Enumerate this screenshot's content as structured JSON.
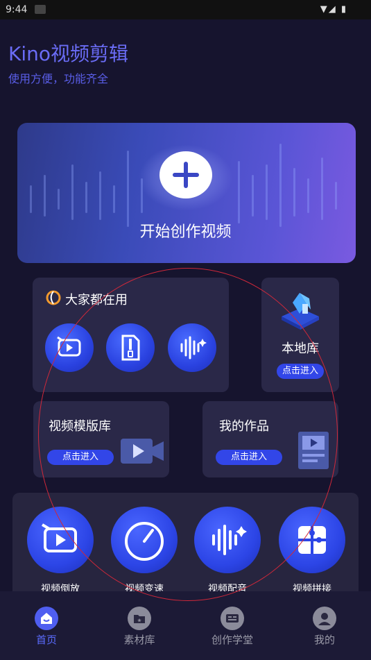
{
  "status_bar": {
    "time": "9:44",
    "right_icons": "▼◢ ▮"
  },
  "header": {
    "title": "Kino视频剪辑",
    "subtitle": "使用方便，功能齐全"
  },
  "hero": {
    "label": "开始创作视频",
    "icon": "plus-icon"
  },
  "popular": {
    "title": "大家都在用",
    "tools": [
      {
        "icon": "video-reverse-icon"
      },
      {
        "icon": "zip-file-icon"
      },
      {
        "icon": "audio-wave-icon"
      }
    ]
  },
  "local_library": {
    "title": "本地库",
    "button": "点击进入"
  },
  "templates": {
    "title": "视频模版库",
    "button": "点击进入"
  },
  "my_works": {
    "title": "我的作品",
    "button": "点击进入"
  },
  "tools": [
    {
      "label": "视频倒放",
      "icon": "video-reverse-icon"
    },
    {
      "label": "视频变速",
      "icon": "speedometer-icon"
    },
    {
      "label": "视频配音",
      "icon": "audio-wave-icon"
    },
    {
      "label": "视频拼接",
      "icon": "puzzle-icon"
    }
  ],
  "tabs": [
    {
      "label": "首页",
      "icon": "home-icon",
      "active": true
    },
    {
      "label": "素材库",
      "icon": "folder-icon",
      "active": false
    },
    {
      "label": "创作学堂",
      "icon": "card-icon",
      "active": false
    },
    {
      "label": "我的",
      "icon": "user-icon",
      "active": false
    }
  ],
  "colors": {
    "accent": "#3246e8",
    "tab_active": "#5b6cff",
    "title": "#6a6cf5"
  }
}
